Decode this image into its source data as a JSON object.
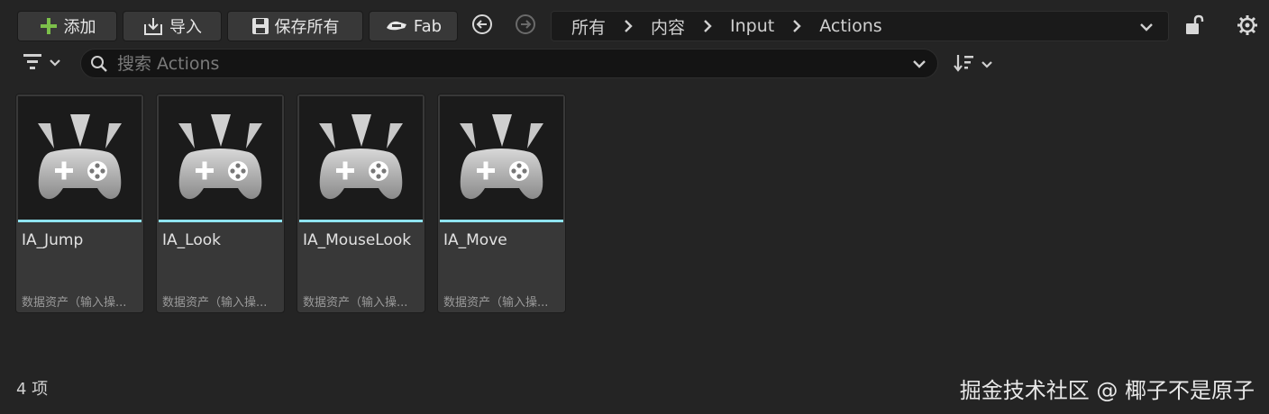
{
  "toolbar": {
    "add_label": "添加",
    "import_label": "导入",
    "save_all_label": "保存所有",
    "fab_label": "Fab"
  },
  "breadcrumb": {
    "items": [
      "所有",
      "内容",
      "Input",
      "Actions"
    ]
  },
  "search": {
    "placeholder": "搜索 Actions"
  },
  "assets": [
    {
      "name": "IA_Jump",
      "type": "数据资产（输入操..."
    },
    {
      "name": "IA_Look",
      "type": "数据资产（输入操..."
    },
    {
      "name": "IA_MouseLook",
      "type": "数据资产（输入操..."
    },
    {
      "name": "IA_Move",
      "type": "数据资产（输入操..."
    }
  ],
  "status": {
    "item_count": "4 项"
  },
  "watermark": "掘金技术社区 @ 椰子不是原子",
  "colors": {
    "accent": "#8fe3f0",
    "add_icon": "#7cc04a",
    "background": "#242424"
  }
}
